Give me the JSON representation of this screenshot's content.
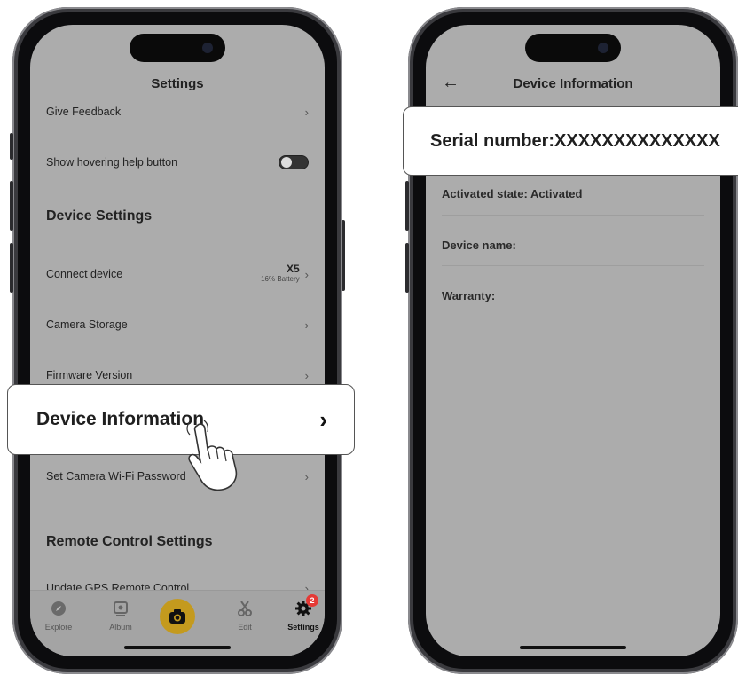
{
  "left_phone": {
    "title": "Settings",
    "rows": [
      {
        "label": "Give Feedback"
      },
      {
        "label": "Show hovering help button"
      },
      {
        "label": "Connect device",
        "device_model": "X5",
        "battery": "16% Battery"
      },
      {
        "label": "Camera Storage"
      },
      {
        "label": "Firmware Version"
      },
      {
        "label": "Set Camera Wi-Fi Password"
      },
      {
        "label": "Update GPS Remote Control"
      }
    ],
    "sections": {
      "device_settings": "Device Settings",
      "remote_control_settings": "Remote Control Settings"
    },
    "highlight_label": "Device Information",
    "tabs": [
      {
        "label": "Explore",
        "icon": "compass-icon"
      },
      {
        "label": "Album",
        "icon": "album-icon"
      },
      {
        "label": "",
        "icon": "camera-icon"
      },
      {
        "label": "Edit",
        "icon": "scissors-icon"
      },
      {
        "label": "Settings",
        "icon": "gear-icon",
        "badge": "2"
      }
    ],
    "help_toggle": false
  },
  "right_phone": {
    "title": "Device Information",
    "serial_callout": "Serial number:XXXXXXXXXXXXXX",
    "rows": [
      {
        "label": "Activated state: Activated"
      },
      {
        "label": "Device name:"
      },
      {
        "label": "Warranty:"
      }
    ]
  },
  "colors": {
    "screen_bg": "#acacac",
    "shutter": "#c49a1e",
    "badge": "#e53935"
  }
}
